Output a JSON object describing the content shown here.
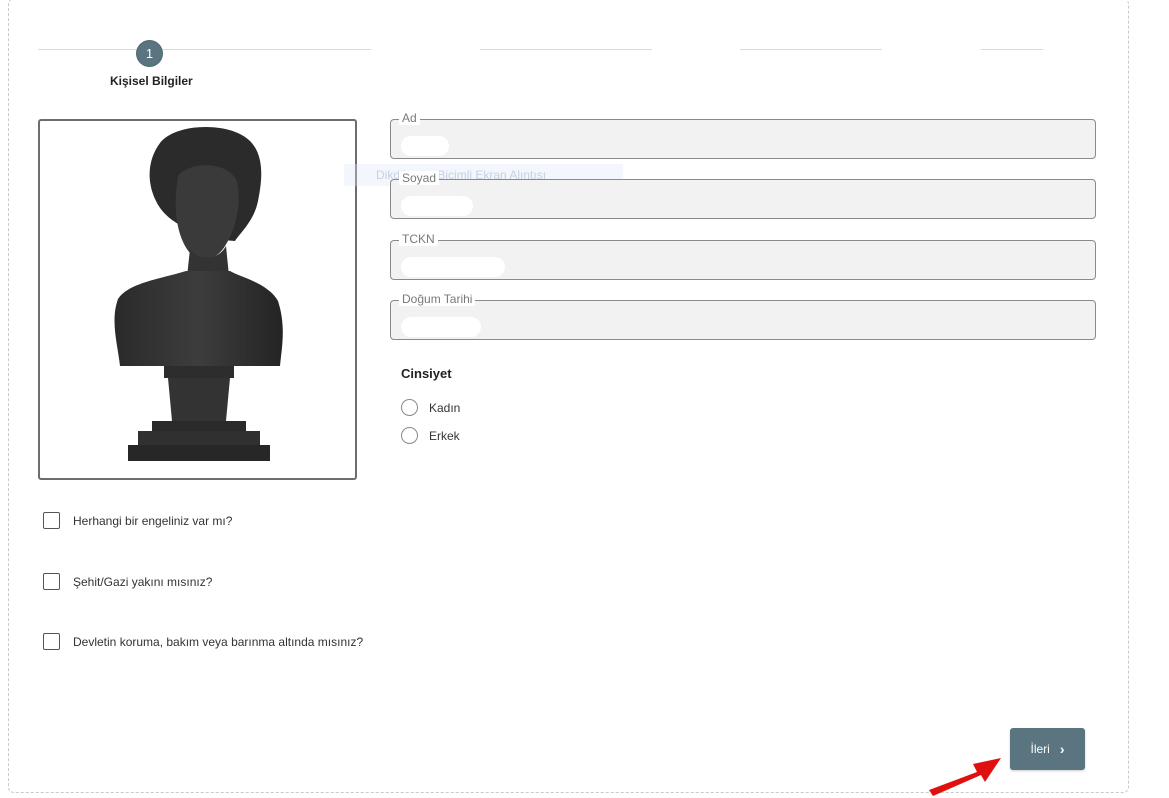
{
  "stepper": {
    "current_step": "1",
    "current_label": "Kişisel Bilgiler"
  },
  "form": {
    "fields": [
      {
        "label": "Ad",
        "value": ""
      },
      {
        "label": "Soyad",
        "value": ""
      },
      {
        "label": "TCKN",
        "value": ""
      },
      {
        "label": "Doğum Tarihi",
        "value": ""
      }
    ],
    "gender": {
      "title": "Cinsiyet",
      "options": [
        "Kadın",
        "Erkek"
      ]
    },
    "checkboxes": [
      "Herhangi bir engeliniz var mı?",
      "Şehit/Gazi yakını mısınız?",
      "Devletin koruma, bakım veya barınma altında mısınız?"
    ]
  },
  "actions": {
    "next_label": "İleri"
  },
  "ghost_tooltip": "Dikdörtgen Biçimli Ekran Alıntısı",
  "colors": {
    "accent": "#5a7480",
    "annotation_arrow": "#e01010"
  },
  "icons": {
    "next": "chevron-right-icon",
    "annotation": "red-arrow-icon"
  }
}
